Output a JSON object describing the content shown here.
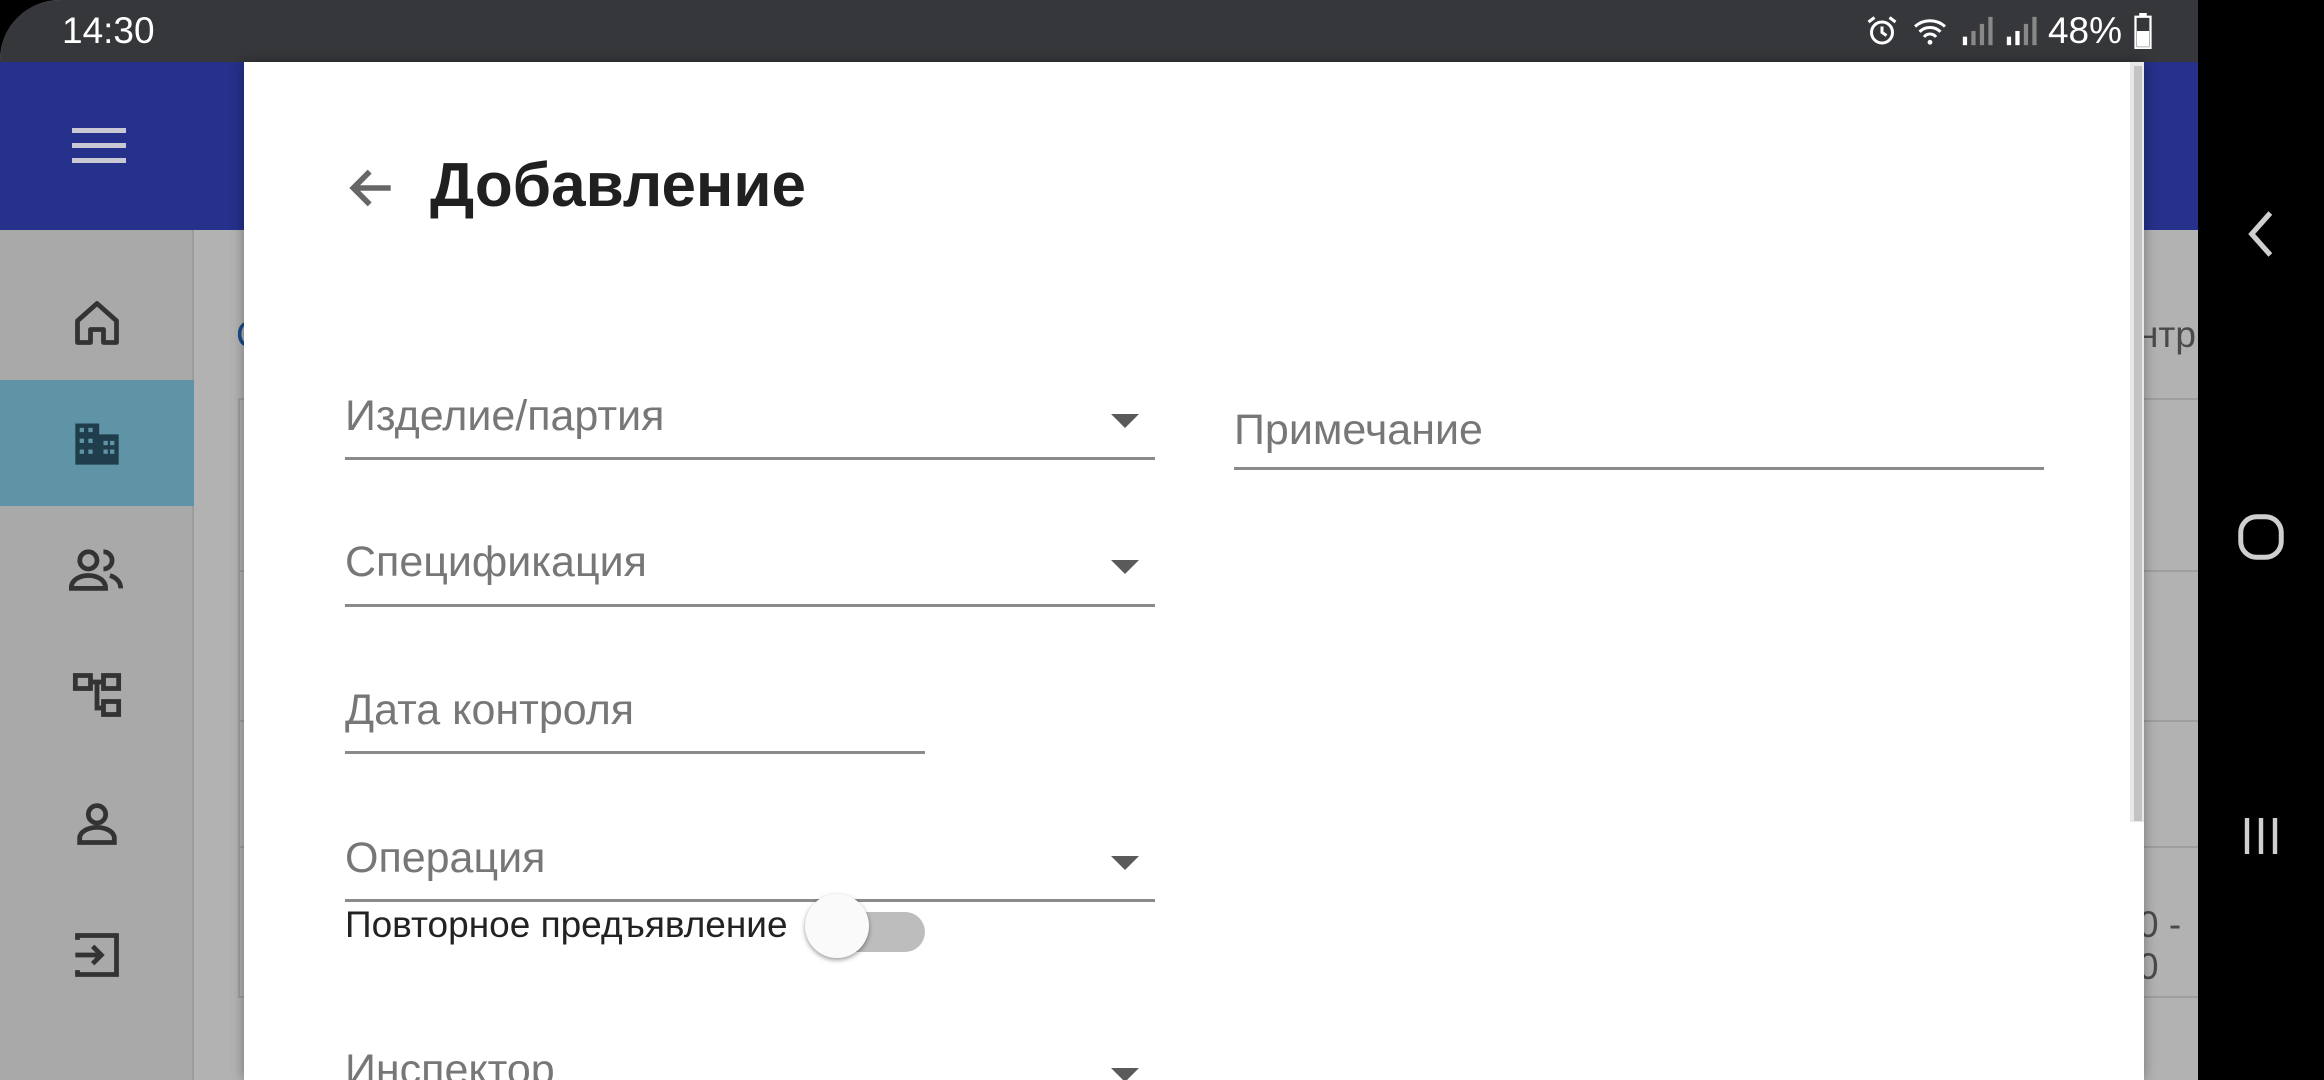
{
  "statusbar": {
    "time": "14:30",
    "battery_percent": "48%",
    "icons": [
      "alarm-icon",
      "wifi-icon",
      "signal-icon",
      "signal-icon",
      "battery-icon"
    ]
  },
  "appbar": {
    "menu_icon": "hamburger-icon"
  },
  "sidenav": {
    "items": [
      {
        "icon": "home-icon"
      },
      {
        "icon": "buildings-icon",
        "active": true
      },
      {
        "icon": "people-icon"
      },
      {
        "icon": "hierarchy-icon"
      },
      {
        "icon": "person-icon"
      },
      {
        "icon": "logout-icon"
      }
    ]
  },
  "background": {
    "partial_text_1": "С",
    "partial_text_2": "нтр",
    "partial_text_3": "0 - 0"
  },
  "dialog": {
    "title": "Добавление",
    "fields": {
      "product": "Изделие/партия",
      "specification": "Спецификация",
      "control_date": "Дата контроля",
      "operation": "Операция",
      "inspector": "Инспектор",
      "note": "Примечание"
    },
    "repeat_toggle": {
      "label": "Повторное предъявление",
      "checked": false
    }
  },
  "system_nav": [
    "back-icon",
    "home-circle-icon",
    "recents-icon"
  ],
  "colors": {
    "appbar": "#25318a",
    "active_nav": "#5f93a6",
    "statusbar": "#36373a"
  }
}
